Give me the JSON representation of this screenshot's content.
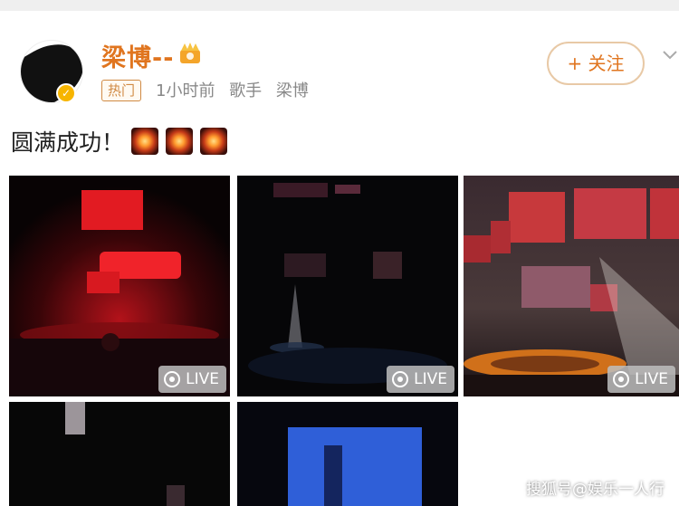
{
  "user": {
    "name": "梁博--",
    "tag": "热门",
    "time": "1小时前",
    "category": "歌手",
    "related": "梁博"
  },
  "follow_label": "+ 关注",
  "post": {
    "text": "圆满成功！"
  },
  "live_label": "LIVE",
  "watermark": "搜狐号@娱乐一人行",
  "colors": {
    "brand": "#e0751f",
    "tag": "#d08a44",
    "meta": "#888888"
  }
}
